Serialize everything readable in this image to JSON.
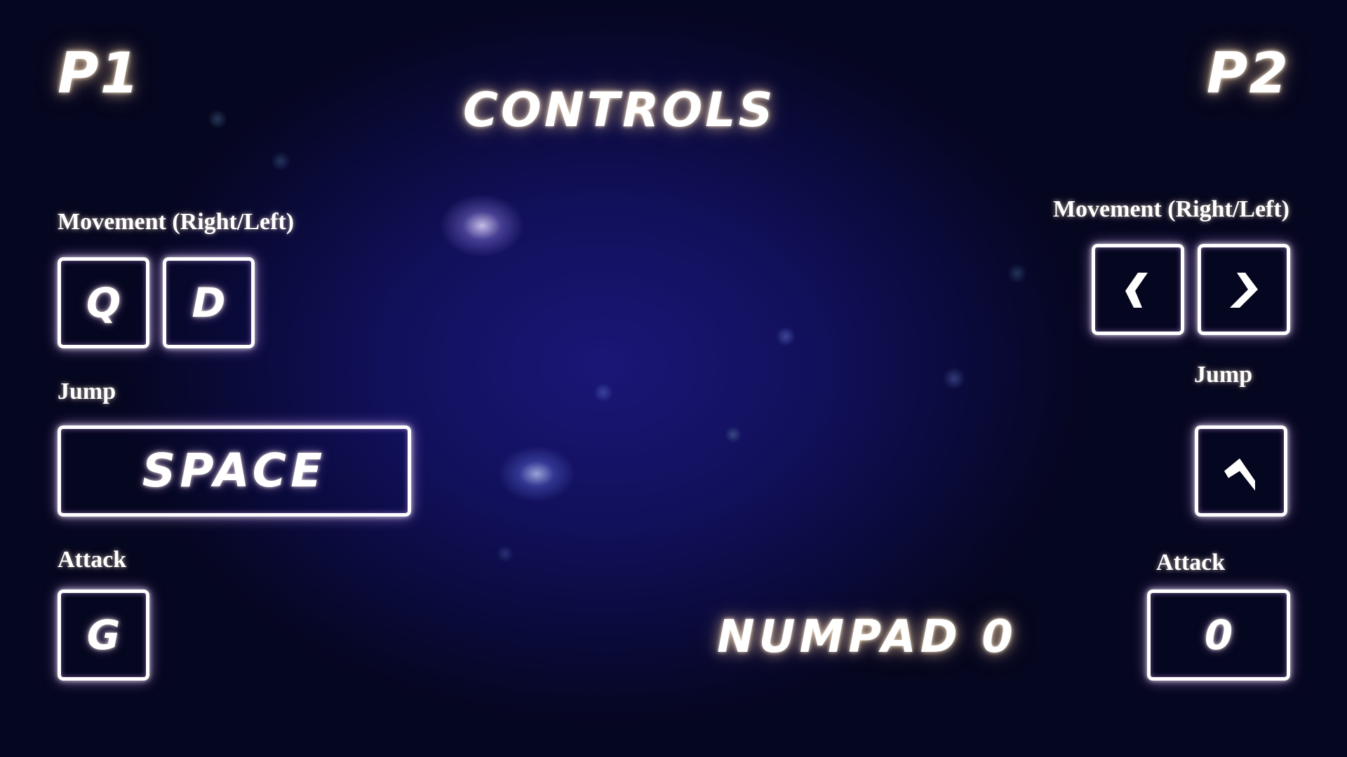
{
  "screen": {
    "title": "CONTROLS"
  },
  "players": {
    "p1": {
      "label": "P1",
      "movement_label": "Movement (Right/Left)",
      "movement_keys": [
        "Q",
        "D"
      ],
      "jump_label": "Jump",
      "jump_key": "SPACE",
      "attack_label": "Attack",
      "attack_key": "G"
    },
    "p2": {
      "label": "P2",
      "movement_label": "Movement (Right/Left)",
      "movement_keys": [
        "left-arrow-icon",
        "right-arrow-icon"
      ],
      "jump_label": "Jump",
      "jump_key": "up-arrow-icon",
      "attack_label": "Attack",
      "attack_key": "0",
      "attack_key_description": "NUMPAD 0"
    }
  },
  "colors": {
    "text": "#ffffff",
    "key_border": "#ffffff",
    "title_glow": "#ffd9a0",
    "key_glow": "#dcaaff",
    "background_center": "#1a1677",
    "background_edge": "#05061f"
  }
}
